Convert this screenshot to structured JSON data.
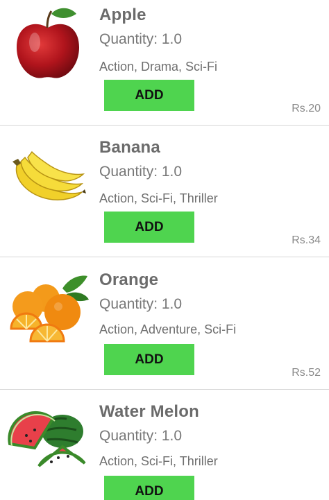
{
  "items": [
    {
      "name": "Apple",
      "quantity": "Quantity: 1.0",
      "genres": "Action, Drama, Sci-Fi",
      "button_label": "ADD",
      "price": "Rs.20",
      "icon": "apple-image"
    },
    {
      "name": "Banana",
      "quantity": "Quantity: 1.0",
      "genres": "Action, Sci-Fi, Thriller",
      "button_label": "ADD",
      "price": "Rs.34",
      "icon": "banana-image"
    },
    {
      "name": "Orange",
      "quantity": "Quantity: 1.0",
      "genres": "Action, Adventure, Sci-Fi",
      "button_label": "ADD",
      "price": "Rs.52",
      "icon": "orange-image"
    },
    {
      "name": "Water Melon",
      "quantity": "Quantity: 1.0",
      "genres": "Action, Sci-Fi, Thriller",
      "button_label": "ADD",
      "price": "",
      "icon": "watermelon-image"
    }
  ],
  "colors": {
    "add_button": "#4fd44f",
    "divider": "#d6d6d6",
    "name_text": "#6b6b6b"
  }
}
